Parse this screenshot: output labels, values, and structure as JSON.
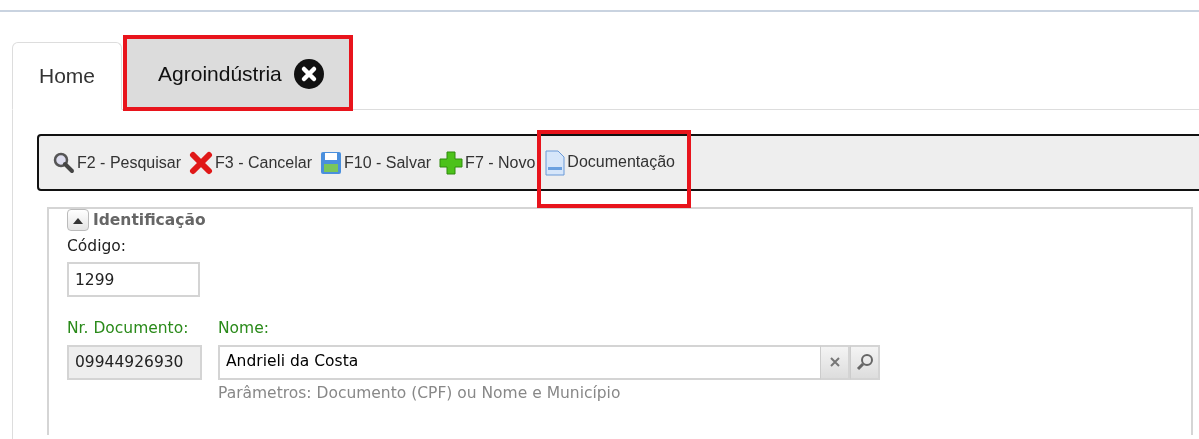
{
  "tabs": [
    {
      "label": "Home",
      "selected": true,
      "closable": false,
      "highlighted": false
    },
    {
      "label": "Agroindústria",
      "selected": false,
      "closable": true,
      "highlighted": true
    }
  ],
  "toolbar": [
    {
      "kind": "search",
      "label": "F2 - Pesquisar",
      "highlighted": false
    },
    {
      "kind": "cancel",
      "label": "F3 - Cancelar",
      "highlighted": false
    },
    {
      "kind": "save",
      "label": "F10 - Salvar",
      "highlighted": false
    },
    {
      "kind": "new",
      "label": "F7 - Novo",
      "highlighted": false
    },
    {
      "kind": "document",
      "label": "Documentação",
      "highlighted": true
    }
  ],
  "section": {
    "title": "Identificação",
    "expanded": true,
    "codigo": {
      "label": "Código:",
      "value": "1299"
    },
    "documento": {
      "label": "Nr. Documento:",
      "value": "09944926930",
      "disabled": true
    },
    "nome": {
      "label": "Nome:",
      "value": "Andrieli da Costa",
      "hint": "Parâmetros: Documento (CPF) ou Nome e Município"
    }
  }
}
